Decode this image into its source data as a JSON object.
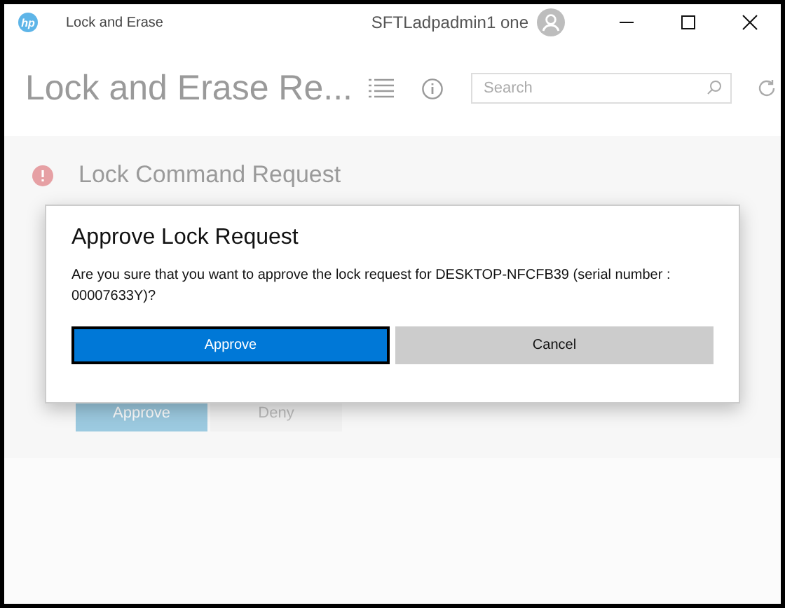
{
  "window": {
    "logo": "hp",
    "title": "Lock and Erase",
    "user": "SFTLadpadmin1 one"
  },
  "header": {
    "title": "Lock and Erase Re...",
    "search": {
      "placeholder": "Search"
    }
  },
  "request": {
    "title": "Lock Command Request",
    "buttons": [
      {
        "label": "Approve",
        "kind": "primary"
      },
      {
        "label": "Deny",
        "kind": "secondary"
      }
    ]
  },
  "dialog": {
    "title": "Approve Lock Request",
    "message": "Are you sure that you want to approve the lock request for DESKTOP-NFCFB39 (serial number : 00007633Y)?",
    "buttons": [
      {
        "label": "Approve",
        "kind": "primary",
        "focused": true
      },
      {
        "label": "Cancel",
        "kind": "secondary",
        "focused": false
      }
    ]
  }
}
